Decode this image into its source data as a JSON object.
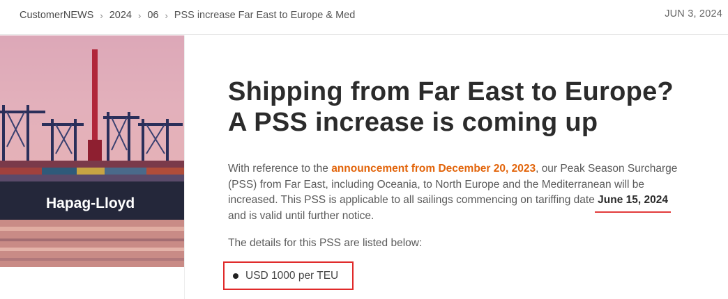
{
  "breadcrumb": {
    "root": "CustomerNEWS",
    "year": "2024",
    "month": "06",
    "current": "PSS increase Far East to Europe & Med",
    "separator": ">"
  },
  "date": "JUN 3, 2024",
  "hero": {
    "logo_text": "Hapag-Lloyd"
  },
  "article": {
    "title_line1": "Shipping from Far East to Europe?",
    "title_line2": "A PSS increase is coming up",
    "para_intro": "With reference to the ",
    "link_text": "announcement from December 20, 2023",
    "para_mid": ", our Peak Season Surcharge (PSS) from Far East, including Oceania, to North Europe and the Mediterranean will be increased. This PSS is applicable to all sailings commencing on tariffing date ",
    "highlight_date": "June 15, 2024",
    "para_end": " and is valid until further notice.",
    "details_intro": "The details for this PSS are listed below:",
    "bullet": "USD 1000 per TEU"
  },
  "colors": {
    "link_orange": "#e2640a",
    "annotation_red": "#e02a2a",
    "text": "#5a5a5a"
  }
}
